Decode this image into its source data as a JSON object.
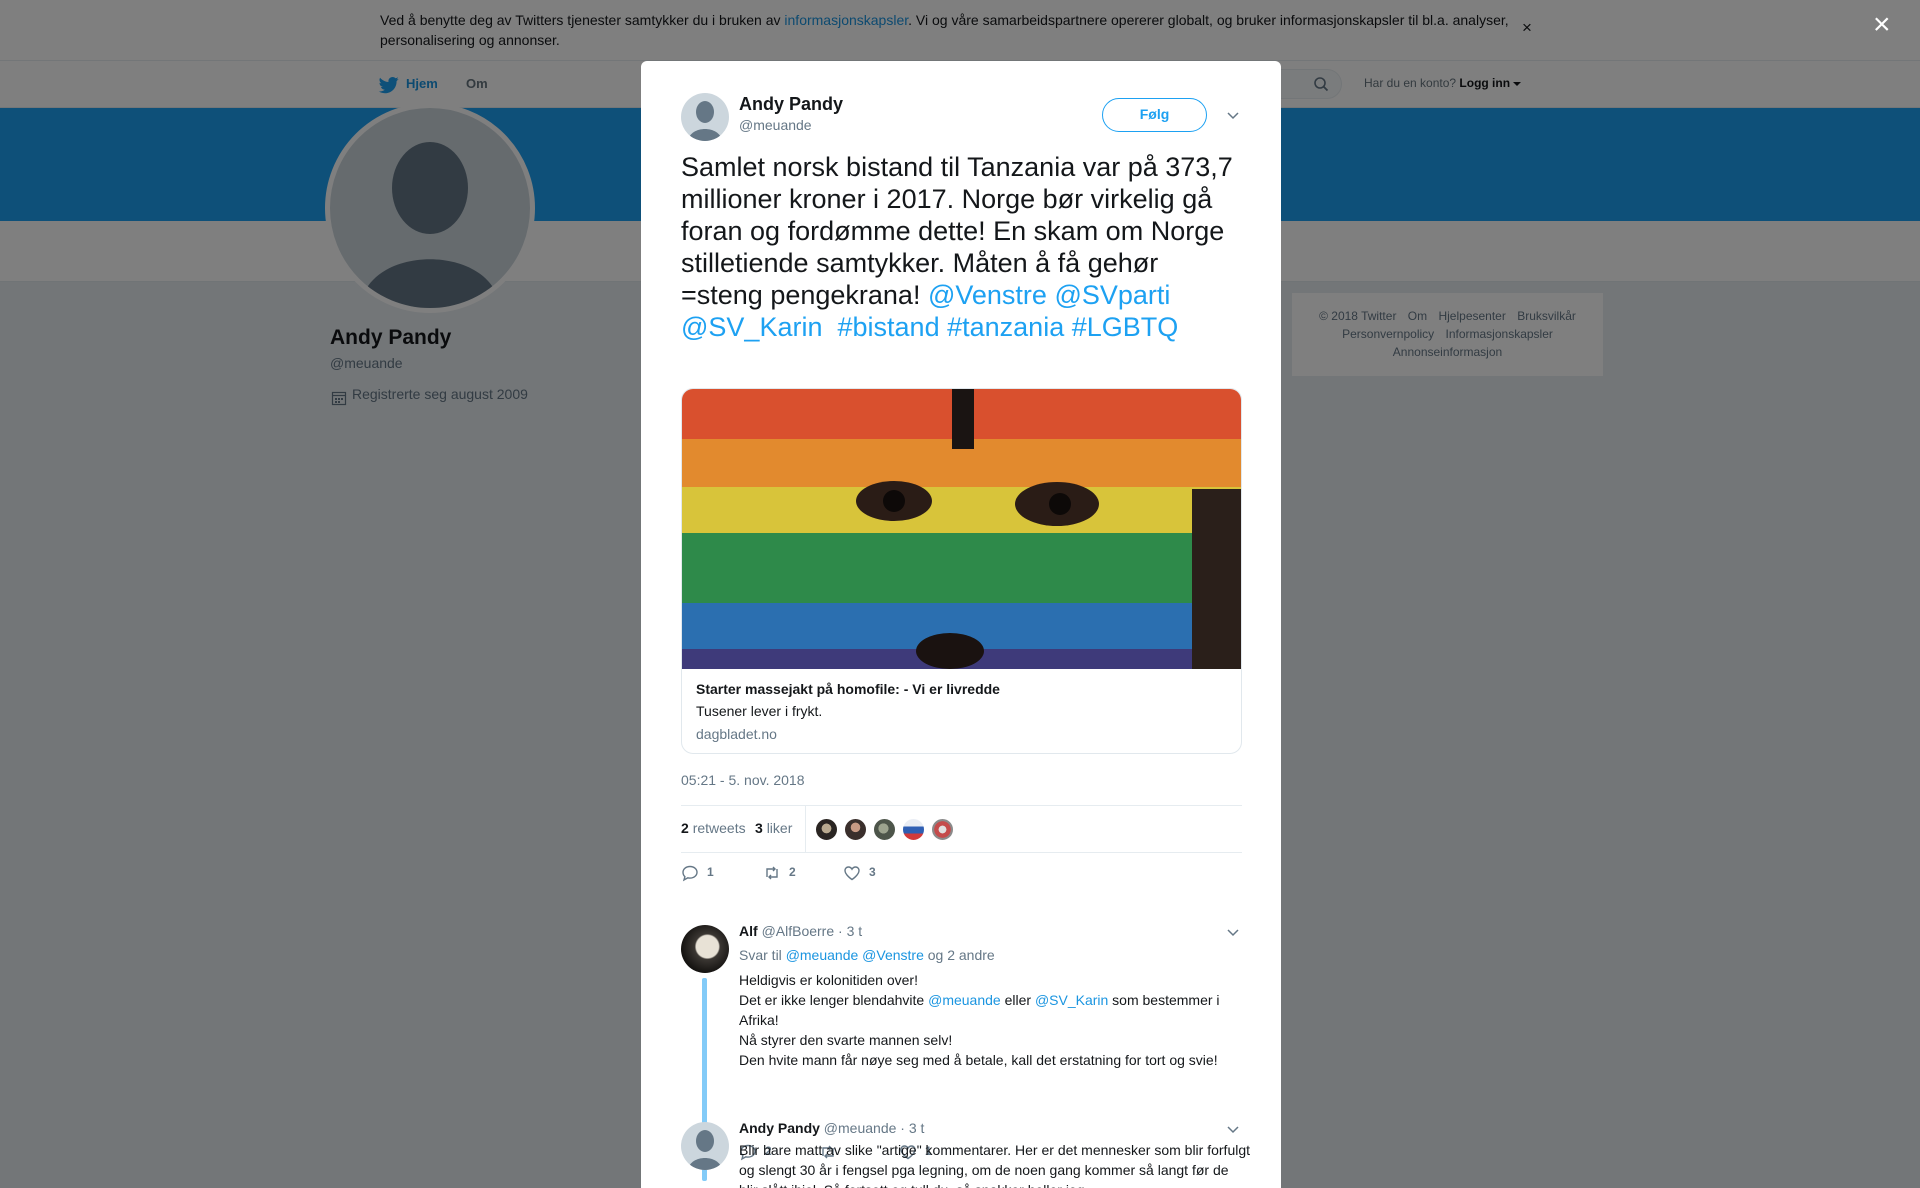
{
  "cookie": {
    "text_before": "Ved å benytte deg av Twitters tjenester samtykker du i bruken av ",
    "link": "informasjonskapsler",
    "text_after": ". Vi og våre samarbeidspartnere opererer globalt, og bruker informasjonskapsler til bl.a. analyser, personalisering og annonser.",
    "close": "×"
  },
  "nav": {
    "home": "Hjem",
    "about": "Om",
    "account_prompt": "Har du en konto?",
    "login": "Logg inn"
  },
  "profile": {
    "name": "Andy Pandy",
    "handle": "@meuande",
    "joined": "Registrerte seg august 2009"
  },
  "footer": {
    "line1": [
      "© 2018 Twitter",
      "Om",
      "Hjelpesenter",
      "Bruksvilkår"
    ],
    "line2": [
      "Personvernpolicy",
      "Informasjonskapsler"
    ],
    "line3": [
      "Annonseinformasjon"
    ]
  },
  "overlay": {
    "close": "×"
  },
  "tweet": {
    "name": "Andy Pandy",
    "handle": "@meuande",
    "follow": "Følg",
    "text": "Samlet norsk bistand til Tanzania var på 373,7 millioner kroner i 2017. Norge bør virkelig gå foran og fordømme dette! En skam om Norge stilletiende samtykker. Måten å få gehør =steng pengekrana! ",
    "mentions": [
      "@Venstre",
      "@SVparti",
      "@SV_Karin"
    ],
    "hashtags": [
      "#bistand",
      "#tanzania",
      "#LGBTQ"
    ],
    "card": {
      "title": "Starter massejakt på homofile: - Vi er livredde",
      "description": "Tusener lever i frykt.",
      "domain": "dagbladet.no"
    },
    "time": "05:21 - 5. nov. 2018",
    "retweets": "2",
    "retweets_label": "retweets",
    "likes": "3",
    "likes_label": "liker",
    "actions": {
      "replies": "1",
      "retweets": "2",
      "likes": "3"
    }
  },
  "replies": [
    {
      "name": "Alf",
      "handle": "@AlfBoerre",
      "time": "· 3 t",
      "reply_to_label": "Svar til",
      "reply_to": [
        "@meuande",
        "@Venstre"
      ],
      "reply_to_more": "og 2 andre",
      "line1": "Heldigvis er kolonitiden over!",
      "line2_a": "Det er ikke lenger blendahvite ",
      "line2_m1": "@meuande",
      "line2_b": " eller ",
      "line2_m2": "@SV_Karin",
      "line2_c": " som bestemmer i Afrika!",
      "line3": "Nå styrer den svarte mannen selv!",
      "line4": "Den hvite mann får nøye seg med å betale, kall det erstatning for tort og svie!",
      "actions": {
        "replies": "2",
        "retweets": "",
        "likes": "1"
      }
    },
    {
      "name": "Andy Pandy",
      "handle": "@meuande",
      "time": "· 3 t",
      "text": "Blir bare matt av slike \"artige\" kommentarer.  Her er det mennesker som blir forfulgt og slengt 30 år i fengsel pga legning, om de noen gang kommer så  langt før de blir slått ihjel. Så fortsett og tull du, så snakker heller jeg"
    }
  ],
  "colors": {
    "accent": "#1da1f2",
    "link": "#1b95e0",
    "muted": "#657786"
  }
}
